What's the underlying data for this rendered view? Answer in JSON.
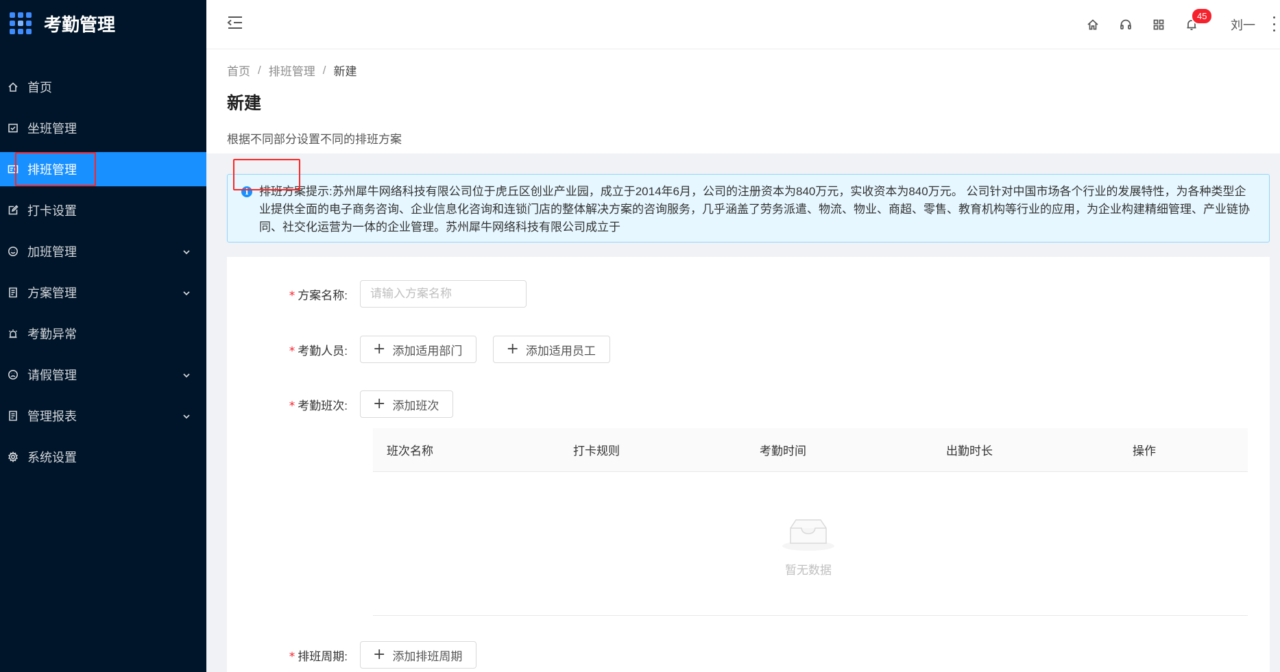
{
  "sidebar": {
    "app_title": "考勤管理",
    "items": [
      {
        "label": "首页",
        "icon": "home-icon"
      },
      {
        "label": "坐班管理",
        "icon": "check-square-icon"
      },
      {
        "label": "排班管理",
        "icon": "schedule-icon"
      },
      {
        "label": "打卡设置",
        "icon": "edit-icon"
      },
      {
        "label": "加班管理",
        "icon": "smile-icon"
      },
      {
        "label": "方案管理",
        "icon": "file-icon"
      },
      {
        "label": "考勤异常",
        "icon": "alarm-icon"
      },
      {
        "label": "请假管理",
        "icon": "frown-icon"
      },
      {
        "label": "管理报表",
        "icon": "file-icon"
      },
      {
        "label": "系统设置",
        "icon": "gear-icon"
      }
    ]
  },
  "header": {
    "notification_count": "45",
    "user_name": "刘一"
  },
  "breadcrumb": {
    "home": "首页",
    "parent": "排班管理",
    "current": "新建",
    "separator": "/"
  },
  "page": {
    "title": "新建",
    "description": "根据不同部分设置不同的排班方案"
  },
  "alert": {
    "text": "排班方案提示:苏州犀牛网络科技有限公司位于虎丘区创业产业园，成立于2014年6月，公司的注册资本为840万元，实收资本为840万元。 公司针对中国市场各个行业的发展特性，为各种类型企业提供全面的电子商务咨询、企业信息化咨询和连锁门店的整体解决方案的咨询服务，几乎涵盖了劳务派遣、物流、物业、商超、零售、教育机构等行业的应用，为企业构建精细管理、产业链协同、社交化运营为一体的企业管理。苏州犀牛网络科技有限公司成立于"
  },
  "form": {
    "required_mark": "*",
    "plan_name": {
      "label": "方案名称:",
      "placeholder": "请输入方案名称",
      "value": ""
    },
    "staff": {
      "label": "考勤人员:",
      "add_department": "添加适用部门",
      "add_employee": "添加适用员工"
    },
    "shift": {
      "label": "考勤班次:",
      "add_shift": "添加班次"
    },
    "cycle": {
      "label": "排班周期:",
      "add_cycle": "添加排班周期"
    },
    "plus": "+"
  },
  "table": {
    "columns": [
      "班次名称",
      "打卡规则",
      "考勤时间",
      "出勤时长",
      "操作"
    ],
    "empty_text": "暂无数据"
  }
}
